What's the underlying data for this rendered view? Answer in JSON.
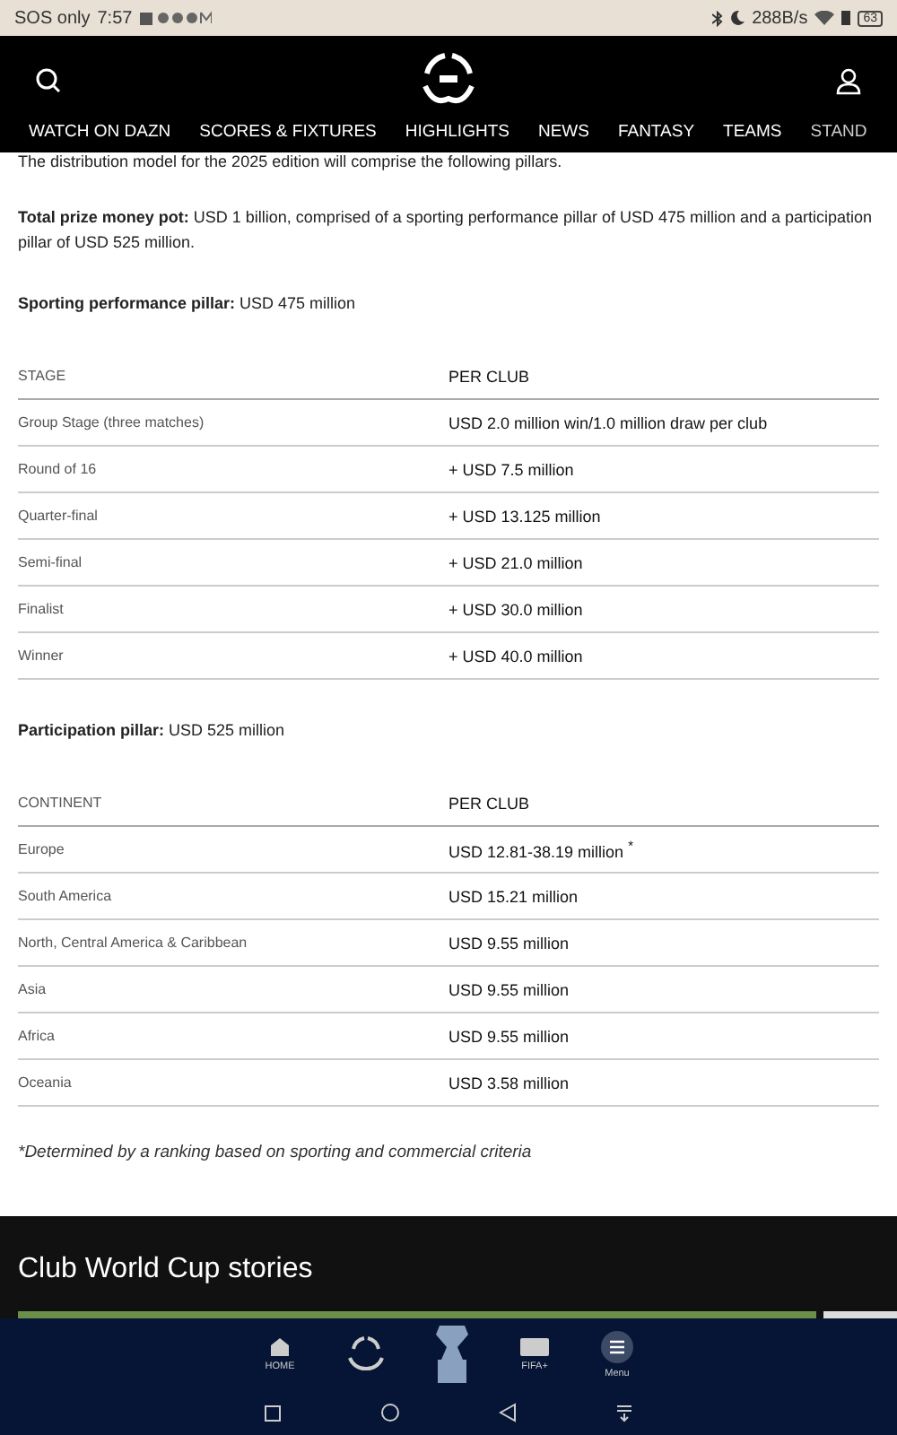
{
  "status_bar": {
    "carrier": "SOS only",
    "time": "7:57",
    "speed": "288B/s",
    "battery": "63"
  },
  "nav": {
    "items": [
      "WATCH ON DAZN",
      "SCORES & FIXTURES",
      "HIGHLIGHTS",
      "NEWS",
      "FANTASY",
      "TEAMS",
      "STAND"
    ]
  },
  "article": {
    "intro": "The distribution model for the 2025 edition will comprise the following pillars.",
    "total": "**Total prize money pot:** USD 1 billion, comprised of a sporting performance pillar of USD 475 million and a participation pillar of USD 525 million.",
    "sporting": "**Sporting performance pillar:** USD 475 million",
    "stage_table": {
      "columns": [
        "STAGE",
        "PER CLUB"
      ],
      "rows": [
        [
          "Group Stage (three matches)",
          "USD 2.0 million win/1.0 million draw per club"
        ],
        [
          "Round of 16",
          "+ USD 7.5 million"
        ],
        [
          "Quarter-final",
          "+ USD 13.125 million"
        ],
        [
          "Semi-final",
          "+ USD 21.0 million"
        ],
        [
          "Finalist",
          "+ USD 30.0 million"
        ],
        [
          "Winner",
          "+ USD 40.0 million"
        ]
      ]
    },
    "participation": "**Participation pillar:** USD 525 million",
    "continent_table": {
      "columns": [
        "CONTINENT",
        "PER CLUB"
      ],
      "rows": [
        [
          "Europe",
          "USD 12.81-38.19 million $^{*}$"
        ],
        [
          "South America",
          "USD 15.21 million"
        ],
        [
          "North, Central America & Caribbean",
          "USD 9.55 million"
        ],
        [
          "Asia",
          "USD 9.55 million"
        ],
        [
          "Africa",
          "USD 9.55 million"
        ],
        [
          "Oceania",
          "USD 3.58 million"
        ]
      ]
    },
    "footnote": "*Determined by a ranking based on sporting and commercial criteria"
  },
  "stories": {
    "title": "Club World Cup stories"
  },
  "bottom_nav": [
    {
      "kind": "home",
      "label": "HOME"
    },
    {
      "kind": "logo"
    },
    {
      "kind": "trophy"
    },
    {
      "kind": "plus",
      "label": "FIFA+"
    },
    {
      "kind": "menu",
      "label": "Menu"
    }
  ]
}
